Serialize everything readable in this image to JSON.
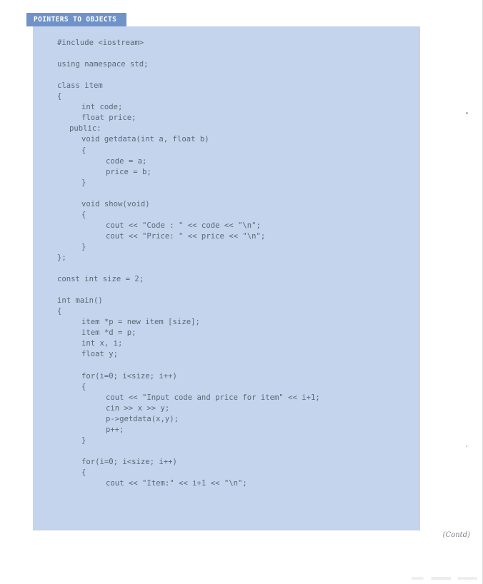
{
  "header": {
    "title": "POINTERS TO OBJECTS"
  },
  "code": {
    "lines": [
      {
        "indent": 0,
        "text": "#include <iostream>"
      },
      {
        "indent": 0,
        "text": ""
      },
      {
        "indent": 0,
        "text": "using namespace std;"
      },
      {
        "indent": 0,
        "text": ""
      },
      {
        "indent": 0,
        "text": "class item"
      },
      {
        "indent": 0,
        "text": "{"
      },
      {
        "indent": 1,
        "text": "int code;"
      },
      {
        "indent": 1,
        "text": "float price;"
      },
      {
        "indent": 0.5,
        "text": "public:"
      },
      {
        "indent": 1,
        "text": "void getdata(int a, float b)"
      },
      {
        "indent": 1,
        "text": "{"
      },
      {
        "indent": 2,
        "text": "code = a;"
      },
      {
        "indent": 2,
        "text": "price = b;"
      },
      {
        "indent": 1,
        "text": "}"
      },
      {
        "indent": 0,
        "text": ""
      },
      {
        "indent": 1,
        "text": "void show(void)"
      },
      {
        "indent": 1,
        "text": "{"
      },
      {
        "indent": 2,
        "text": "cout << \"Code : \" << code << \"\\n\";"
      },
      {
        "indent": 2,
        "text": "cout << \"Price: \" << price << \"\\n\";"
      },
      {
        "indent": 1,
        "text": "}"
      },
      {
        "indent": 0,
        "text": "};"
      },
      {
        "indent": 0,
        "text": ""
      },
      {
        "indent": 0,
        "text": "const int size = 2;"
      },
      {
        "indent": 0,
        "text": ""
      },
      {
        "indent": 0,
        "text": "int main()"
      },
      {
        "indent": 0,
        "text": "{"
      },
      {
        "indent": 1,
        "text": "item *p = new item [size];"
      },
      {
        "indent": 1,
        "text": "item *d = p;"
      },
      {
        "indent": 1,
        "text": "int x, i;"
      },
      {
        "indent": 1,
        "text": "float y;"
      },
      {
        "indent": 0,
        "text": ""
      },
      {
        "indent": 1,
        "text": "for(i=0; i<size; i++)"
      },
      {
        "indent": 1,
        "text": "{"
      },
      {
        "indent": 2,
        "text": "cout << \"Input code and price for item\" << i+1;"
      },
      {
        "indent": 2,
        "text": "cin >> x >> y;"
      },
      {
        "indent": 2,
        "text": "p->getdata(x,y);"
      },
      {
        "indent": 2,
        "text": "p++;"
      },
      {
        "indent": 1,
        "text": "}"
      },
      {
        "indent": 0,
        "text": ""
      },
      {
        "indent": 1,
        "text": "for(i=0; i<size; i++)"
      },
      {
        "indent": 1,
        "text": "{"
      },
      {
        "indent": 2,
        "text": "cout << \"Item:\" << i+1 << \"\\n\";"
      }
    ]
  },
  "footer": {
    "continued": "(Contd)"
  },
  "colors": {
    "header_bg": "#6f93c9",
    "panel_bg": "#c3d4ec",
    "code_text": "#5d6877"
  }
}
